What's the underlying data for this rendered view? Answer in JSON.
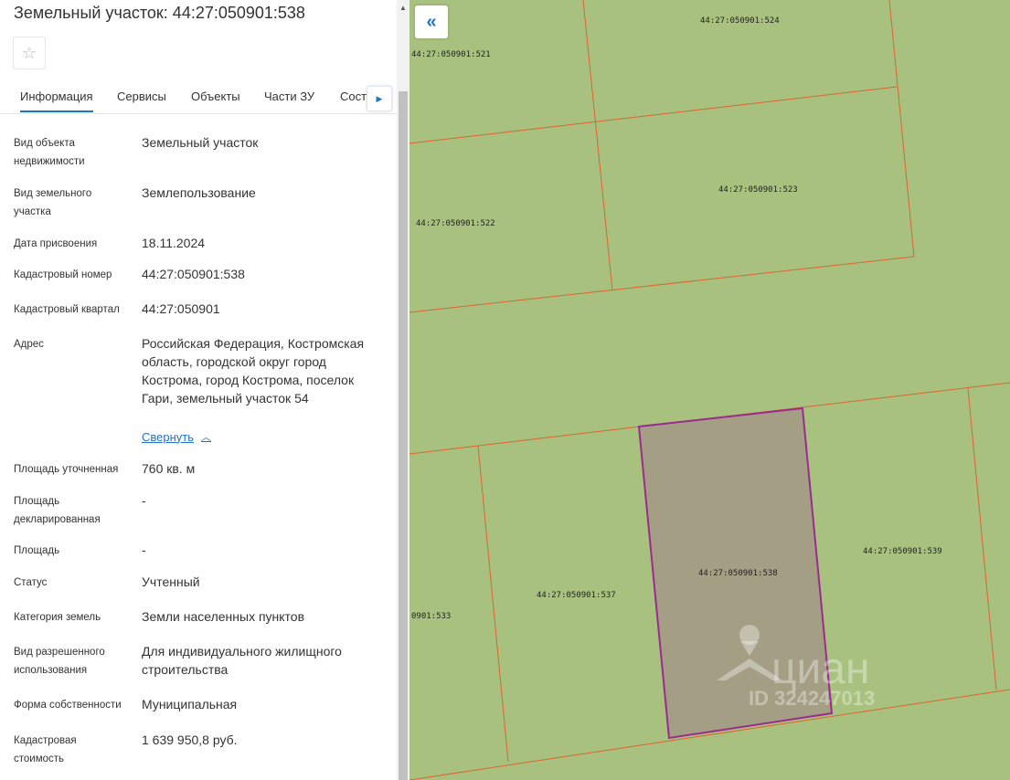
{
  "header": {
    "title": "Земельный участок: 44:27:050901:538"
  },
  "tabs": [
    {
      "label": "Информация"
    },
    {
      "label": "Сервисы"
    },
    {
      "label": "Объекты"
    },
    {
      "label": "Части ЗУ"
    },
    {
      "label": "Состав"
    }
  ],
  "info": {
    "object_type": {
      "label": "Вид объекта недвижимости",
      "value": "Земельный участок"
    },
    "land_type": {
      "label": "Вид земельного участка",
      "value": "Землепользование"
    },
    "assign_date": {
      "label": "Дата присвоения",
      "value": "18.11.2024"
    },
    "cadastral_number": {
      "label": "Кадастровый номер",
      "value": "44:27:050901:538"
    },
    "cadastral_quarter": {
      "label": "Кадастровый квартал",
      "value": "44:27:050901"
    },
    "address": {
      "label": "Адрес",
      "value": "Российская Федерация, Костромская область, городской округ город Кострома, город Кострома, поселок Гари, земельный участок 54"
    },
    "collapse_link": "Свернуть",
    "area_specified": {
      "label": "Площадь уточненная",
      "value": "760 кв. м"
    },
    "area_declared": {
      "label": "Площадь декларированная",
      "value": "-"
    },
    "area": {
      "label": "Площадь",
      "value": "-"
    },
    "status": {
      "label": "Статус",
      "value": "Учтенный"
    },
    "land_category": {
      "label": "Категория земель",
      "value": "Земли населенных пунктов"
    },
    "permitted_use": {
      "label": "Вид разрешенного использования",
      "value": "Для индивидуального жилищного строительства"
    },
    "ownership": {
      "label": "Форма собственности",
      "value": "Муниципальная"
    },
    "cadastral_value": {
      "label": "Кадастровая стоимость",
      "value": "1 639 950,8 руб."
    }
  },
  "map": {
    "parcel_labels": {
      "p521": "44:27:050901:521",
      "p524": "44:27:050901:524",
      "p522": "44:27:050901:522",
      "p523": "44:27:050901:523",
      "p538": "44:27:050901:538",
      "p539": "44:27:050901:539",
      "p537": "44:27:050901:537",
      "p533": "0901:533"
    },
    "watermark_brand": "циан",
    "watermark_id": "ID 324247013",
    "colors": {
      "land": "#a9c17f",
      "boundary": "#e0622e",
      "selected_fill": "#a39e84",
      "selected_border": "#9c2a8f"
    }
  },
  "icons": {
    "favorite": "star-icon",
    "collapse_panel": "double-chevron-left-icon",
    "tabs_next": "chevron-right-icon",
    "collapse_section": "chevron-up-icon"
  }
}
